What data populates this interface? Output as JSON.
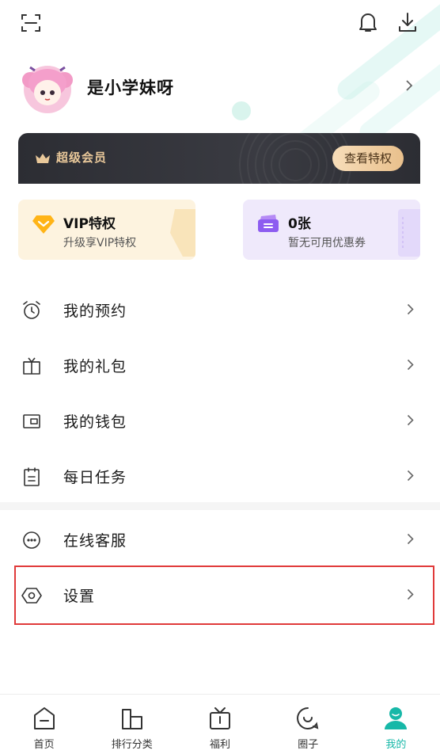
{
  "header": {
    "scan_icon": "scan-icon",
    "bell_icon": "bell-icon",
    "download_icon": "download-icon"
  },
  "profile": {
    "username": "是小学妹呀"
  },
  "super_member": {
    "title": "超级会员",
    "button_label": "查看特权"
  },
  "cards": {
    "vip": {
      "title": "VIP特权",
      "subtitle": "升级享VIP特权"
    },
    "coupon": {
      "title": "0张",
      "subtitle": "暂无可用优惠券"
    }
  },
  "menu_group1": [
    {
      "label": "我的预约",
      "icon": "alarm-clock-icon"
    },
    {
      "label": "我的礼包",
      "icon": "gift-icon"
    },
    {
      "label": "我的钱包",
      "icon": "wallet-icon"
    },
    {
      "label": "每日任务",
      "icon": "clipboard-icon"
    }
  ],
  "menu_group2": [
    {
      "label": "在线客服",
      "icon": "customer-service-icon"
    },
    {
      "label": "设置",
      "icon": "settings-icon"
    }
  ],
  "bottom_nav": [
    {
      "label": "首页",
      "icon": "home-icon"
    },
    {
      "label": "排行分类",
      "icon": "ranking-icon"
    },
    {
      "label": "福利",
      "icon": "gift-box-icon"
    },
    {
      "label": "圈子",
      "icon": "community-icon"
    },
    {
      "label": "我的",
      "icon": "profile-icon"
    }
  ],
  "colors": {
    "accent": "#17b8a8",
    "highlight_border": "#e03a3a",
    "vip_gold": "#e9c89a"
  }
}
